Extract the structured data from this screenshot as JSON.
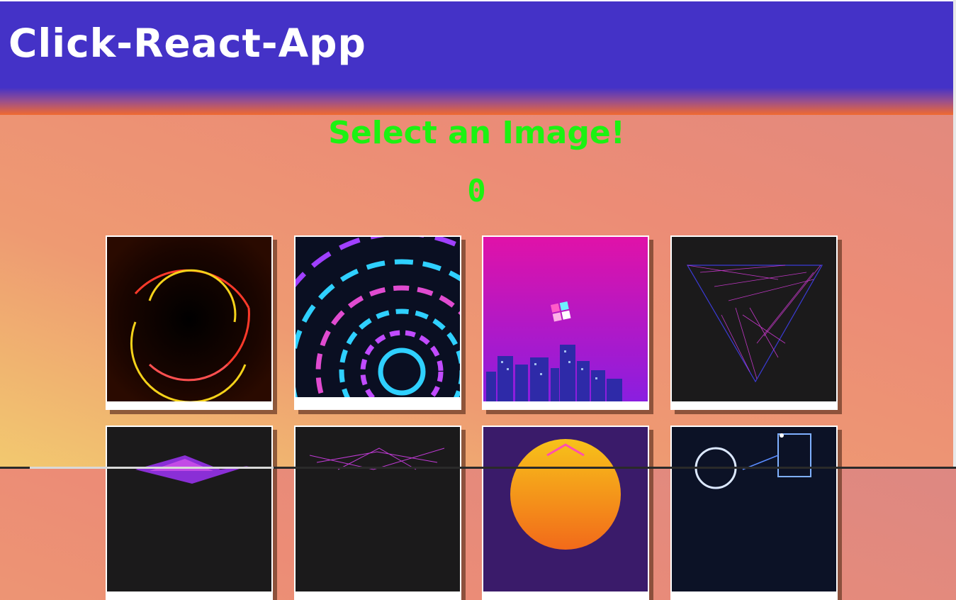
{
  "header": {
    "title": "Click-React-App"
  },
  "game": {
    "prompt": "Select an Image!",
    "score": "0"
  },
  "images": [
    {
      "name": "neon-circles-image"
    },
    {
      "name": "neon-tunnel-image"
    },
    {
      "name": "vaporwave-city-image"
    },
    {
      "name": "string-art-triangle-image"
    },
    {
      "name": "purple-mountain-image"
    },
    {
      "name": "line-mountain-image"
    },
    {
      "name": "sunset-sun-image"
    },
    {
      "name": "neon-shapes-image"
    }
  ]
}
